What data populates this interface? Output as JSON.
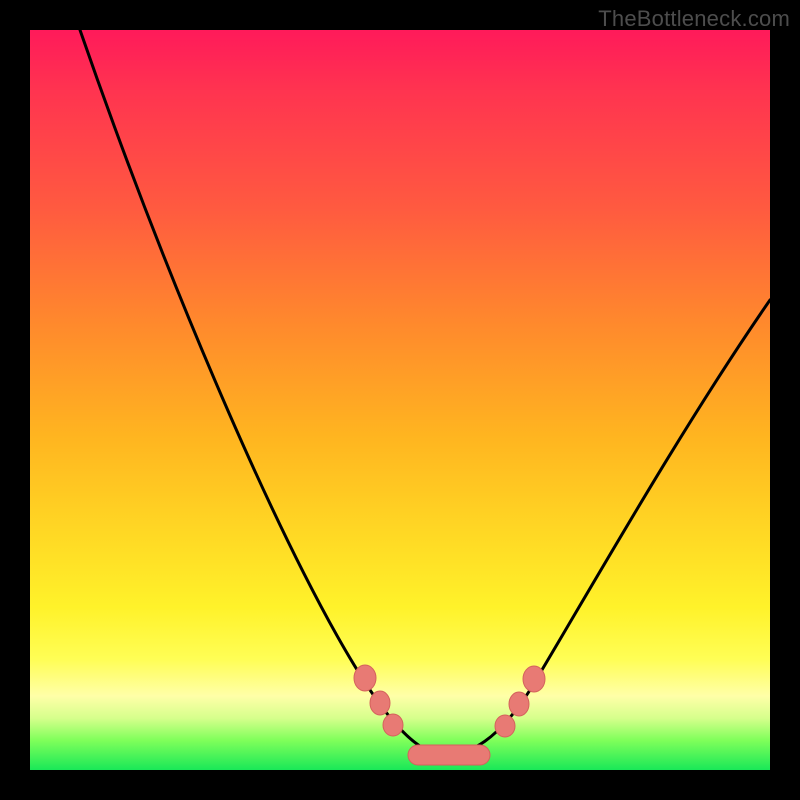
{
  "watermark": "TheBottleneck.com",
  "colors": {
    "frame": "#000000",
    "curve": "#000000",
    "marker_fill": "#e87a74",
    "marker_stroke": "#d4625c",
    "gradient_stops": [
      "#ff1a5a",
      "#ff3350",
      "#ff5a40",
      "#ff8a2c",
      "#ffb520",
      "#ffd824",
      "#fff22a",
      "#fffe55",
      "#ffffa8",
      "#d6ff8c",
      "#7fff5a",
      "#19e858"
    ]
  },
  "chart_data": {
    "type": "line",
    "title": "",
    "xlabel": "",
    "ylabel": "",
    "xlim": [
      0,
      100
    ],
    "ylim": [
      0,
      100
    ],
    "x": [
      10,
      15,
      20,
      25,
      30,
      35,
      40,
      45,
      48,
      50,
      52,
      55,
      58,
      60,
      65,
      70,
      75,
      80,
      85,
      90,
      95,
      100
    ],
    "values": [
      100,
      88,
      76,
      64,
      52,
      41,
      30,
      19,
      11,
      6,
      3,
      1,
      1,
      2,
      4,
      8,
      14,
      22,
      31,
      41,
      52,
      62
    ],
    "markers": [
      {
        "x": 46,
        "y": 13,
        "shape": "circle"
      },
      {
        "x": 48,
        "y": 9,
        "shape": "circle"
      },
      {
        "x": 49,
        "y": 6,
        "shape": "circle"
      },
      {
        "x": 52,
        "y": 2,
        "shape": "rounded_bar_start"
      },
      {
        "x": 60,
        "y": 2,
        "shape": "rounded_bar_end"
      },
      {
        "x": 63,
        "y": 6,
        "shape": "circle"
      },
      {
        "x": 64,
        "y": 9,
        "shape": "circle"
      },
      {
        "x": 66,
        "y": 13,
        "shape": "circle"
      }
    ]
  }
}
